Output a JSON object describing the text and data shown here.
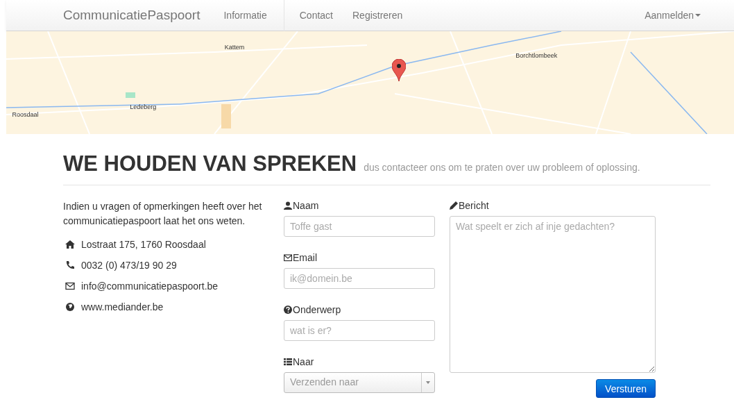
{
  "navbar": {
    "brand": "CommunicatiePaspoort",
    "items": [
      {
        "label": "Informatie",
        "divider_after": true
      },
      {
        "label": "Contact",
        "divider_after": false
      },
      {
        "label": "Registreren",
        "divider_after": false
      }
    ],
    "login": "Aanmelden"
  },
  "map": {
    "labels": [
      "Kattem",
      "Borchtlombeek",
      "Ledeberg",
      "Roosdaal"
    ]
  },
  "heading": {
    "title": "WE HOUDEN VAN SPREKEN",
    "subtitle": "dus contacteer ons om te praten over uw probleem of oplossing."
  },
  "intro": "Indien u vragen of opmerkingen heeft over het communicatiepaspoort laat het ons weten.",
  "contact": [
    {
      "kind": "home",
      "text": "Lostraat 175, 1760 Roosdaal"
    },
    {
      "kind": "phone",
      "text": "0032 (0) 473/19 90 29"
    },
    {
      "kind": "email",
      "text": "info@communicatiepaspoort.be"
    },
    {
      "kind": "globe",
      "text": "www.mediander.be"
    }
  ],
  "fields": [
    {
      "kind": "input",
      "label": "Naam",
      "placeholder": "Toffe gast"
    },
    {
      "kind": "input",
      "label": "Email",
      "placeholder": "ik@domein.be"
    },
    {
      "kind": "input",
      "label": "Onderwerp",
      "placeholder": "wat is er?"
    },
    {
      "kind": "select",
      "label": "Naar",
      "placeholder": "Verzenden naar"
    }
  ],
  "message": {
    "label": "Bericht",
    "placeholder": "Wat speelt er zich af inje gedachten?"
  },
  "submit": "Versturen"
}
